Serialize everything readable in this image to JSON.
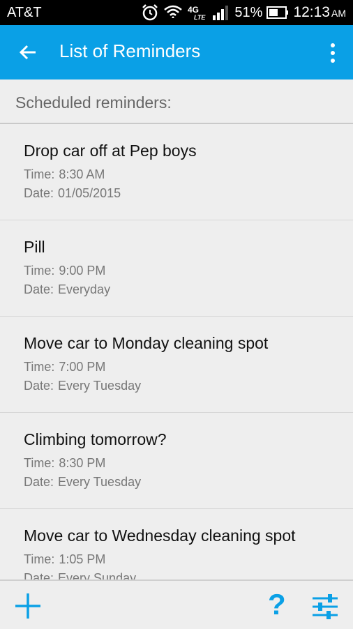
{
  "status_bar": {
    "carrier": "AT&T",
    "battery_percent": "51%",
    "time": "12:13",
    "ampm": "AM",
    "network": "4G LTE",
    "icons": [
      "alarm-icon",
      "wifi-icon",
      "lte-icon",
      "signal-icon",
      "battery-icon"
    ]
  },
  "app_bar": {
    "title": "List of Reminders"
  },
  "section": {
    "label": "Scheduled reminders:"
  },
  "reminders": [
    {
      "title": "Drop car off at Pep boys",
      "time_label": "Time:",
      "time": "8:30 AM",
      "date_label": "Date:",
      "date": "01/05/2015"
    },
    {
      "title": "Pill",
      "time_label": "Time:",
      "time": "9:00 PM",
      "date_label": "Date:",
      "date": "Everyday"
    },
    {
      "title": "Move car to Monday cleaning spot",
      "time_label": "Time:",
      "time": "7:00 PM",
      "date_label": "Date:",
      "date": "Every Tuesday"
    },
    {
      "title": "Climbing tomorrow?",
      "time_label": "Time:",
      "time": "8:30 PM",
      "date_label": "Date:",
      "date": "Every Tuesday"
    },
    {
      "title": "Move car to Wednesday cleaning spot",
      "time_label": "Time:",
      "time": "1:05 PM",
      "date_label": "Date:",
      "date": "Every Sunday"
    }
  ],
  "bottom_bar": {
    "help": "?"
  },
  "colors": {
    "accent": "#0aa0e6",
    "background": "#eeeeee"
  }
}
